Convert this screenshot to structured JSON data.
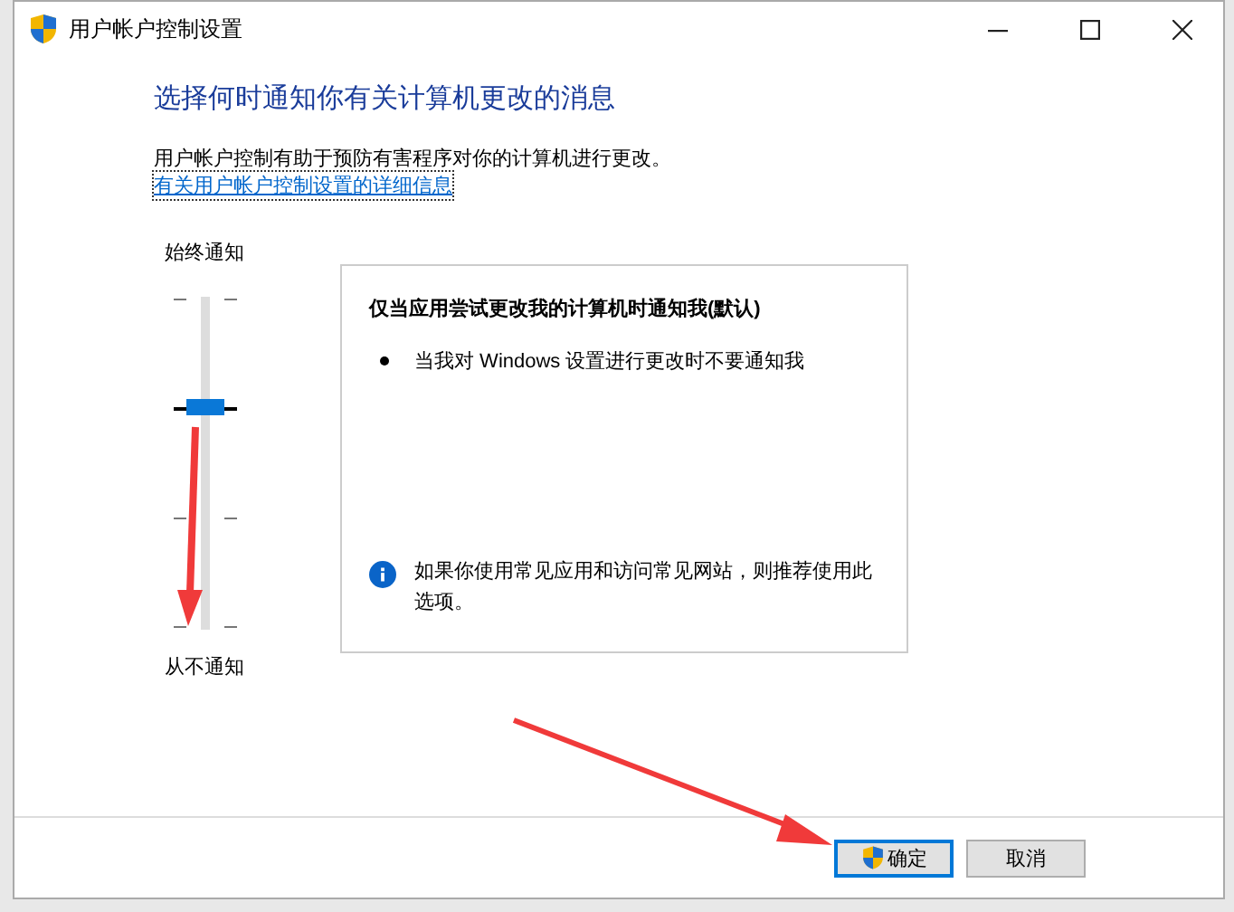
{
  "window": {
    "title": "用户帐户控制设置"
  },
  "heading": "选择何时通知你有关计算机更改的消息",
  "description": "用户帐户控制有助于预防有害程序对你的计算机进行更改。",
  "details_link": "有关用户帐户控制设置的详细信息",
  "slider": {
    "top_label": "始终通知",
    "bottom_label": "从不通知",
    "level": 0.67
  },
  "info_panel": {
    "title": "仅当应用尝试更改我的计算机时通知我(默认)",
    "bullets": [
      "当我对 Windows 设置进行更改时不要通知我"
    ],
    "note": "如果你使用常见应用和访问常见网站，则推荐使用此选项。"
  },
  "buttons": [
    {
      "label": "确定",
      "kind": "primary"
    },
    {
      "label": "取消",
      "kind": "normal"
    }
  ]
}
